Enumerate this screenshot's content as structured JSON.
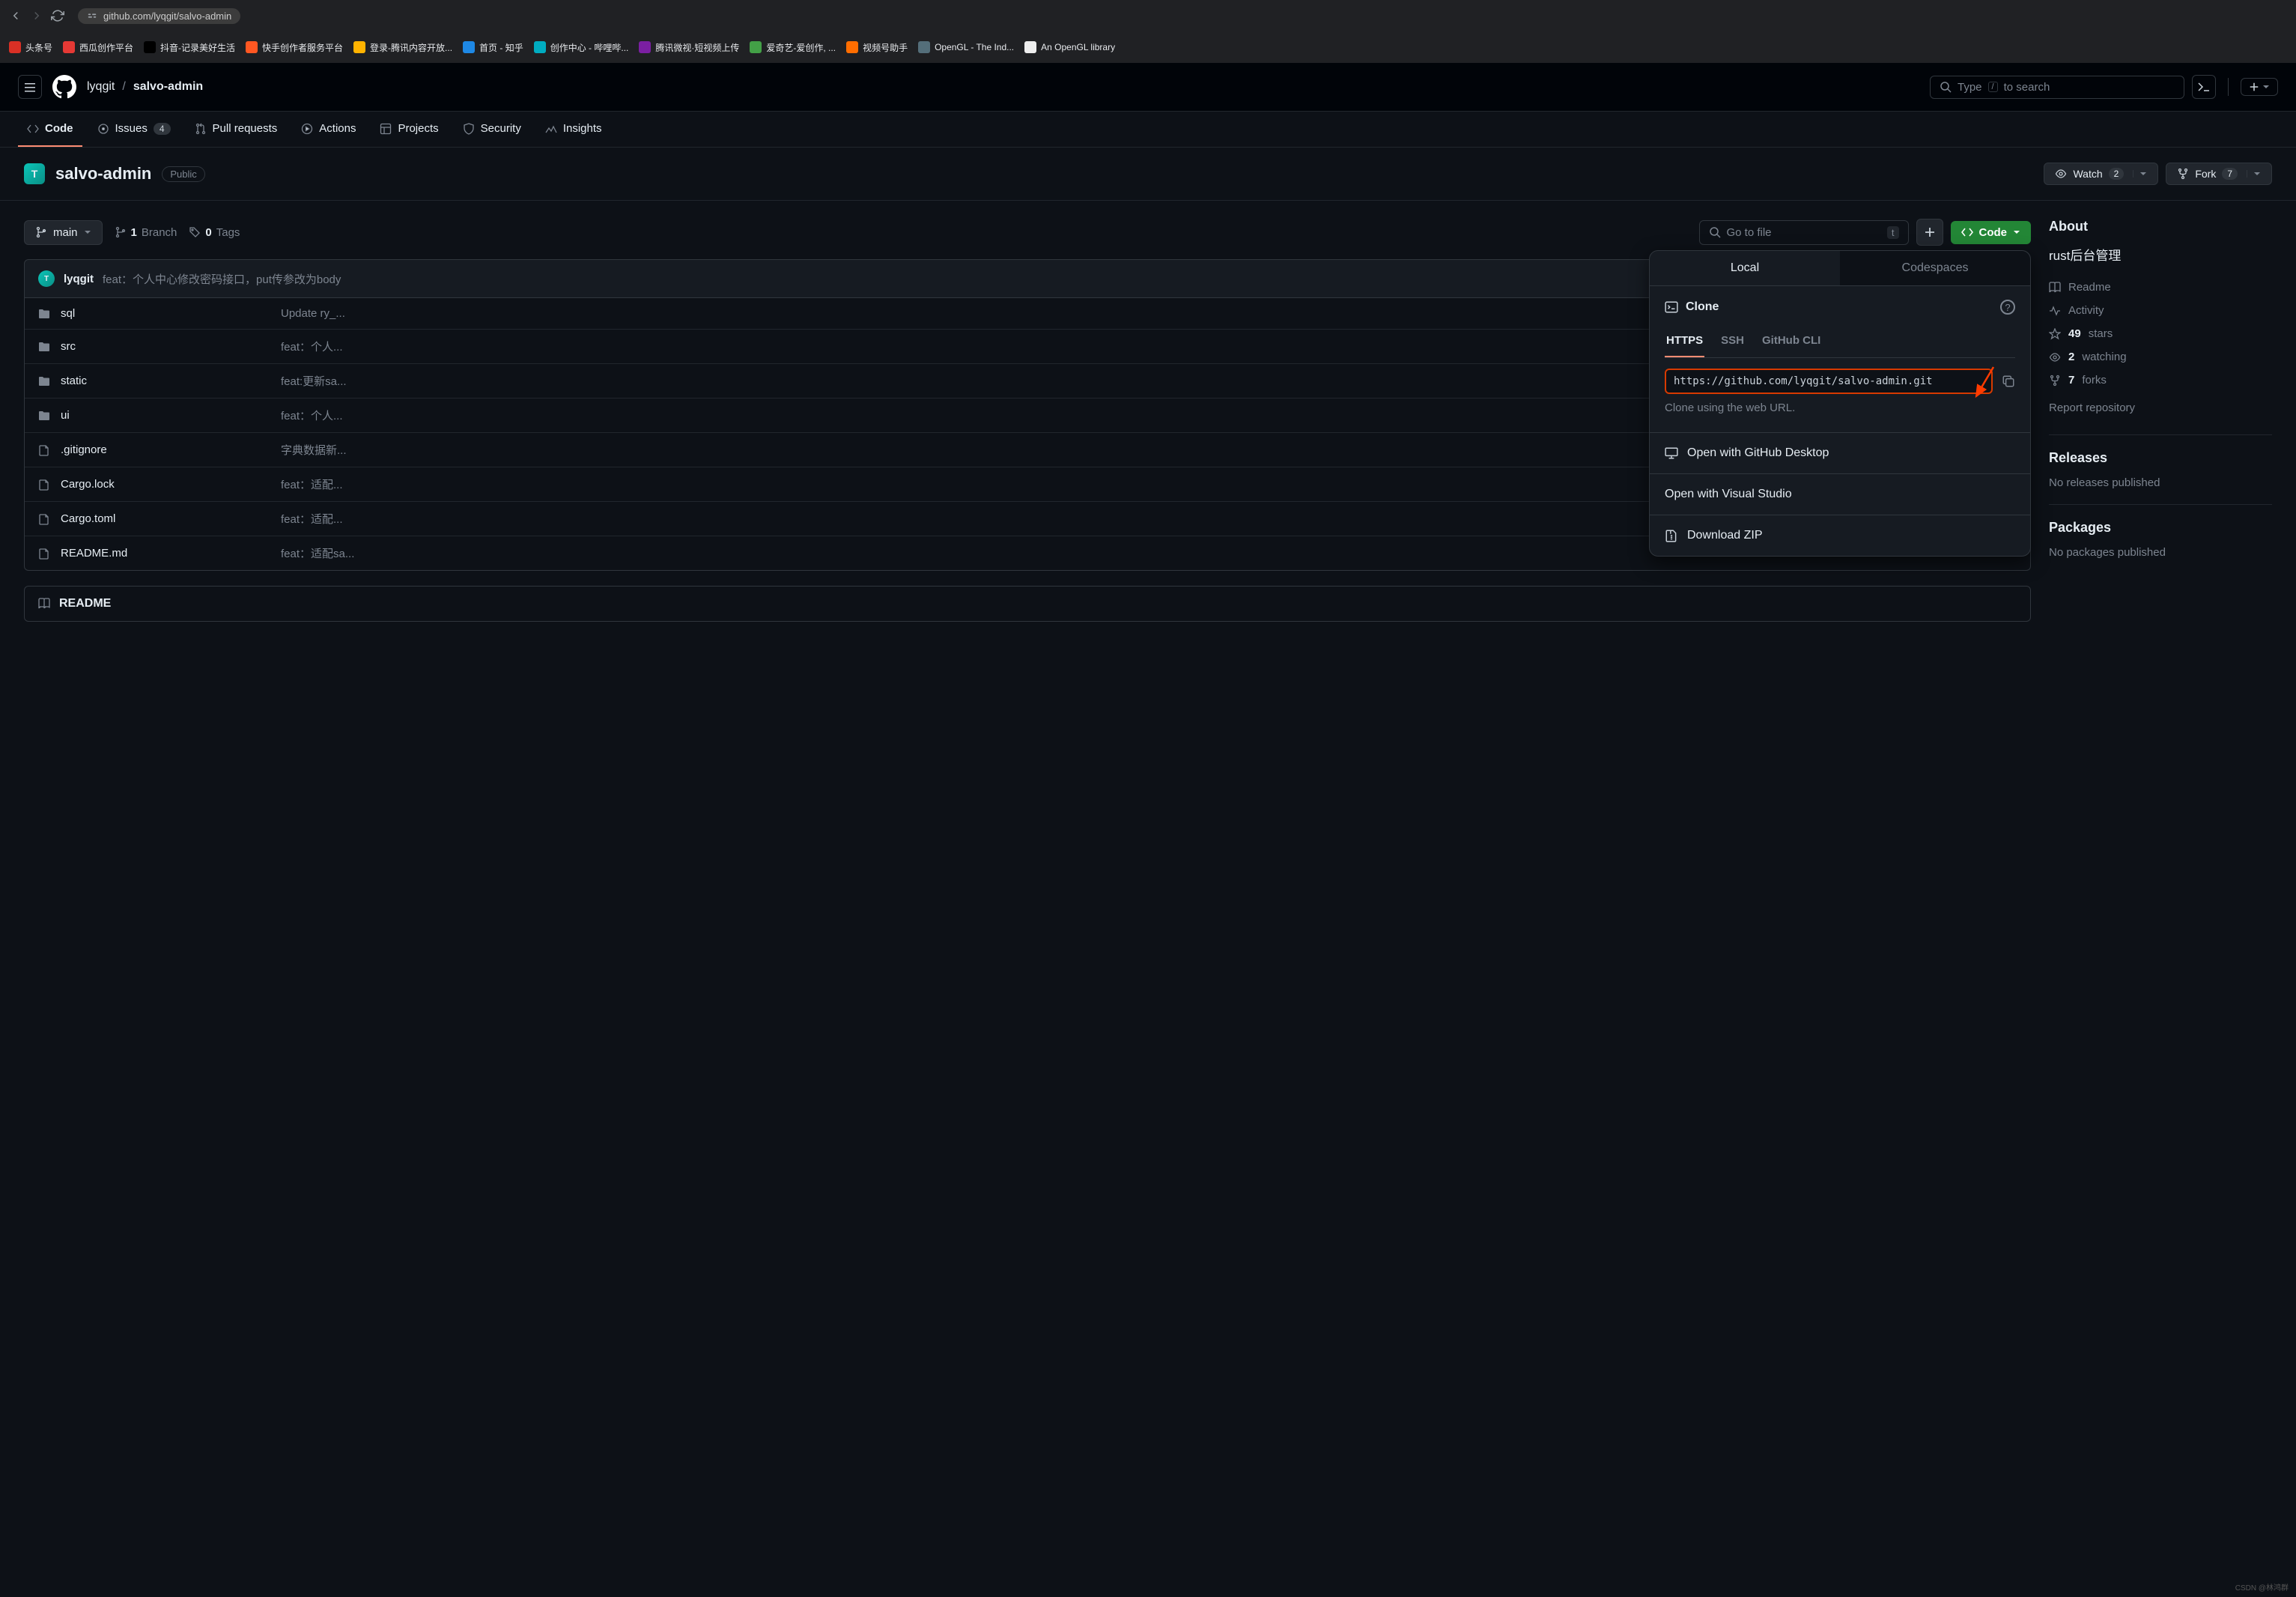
{
  "browser": {
    "url": "github.com/lyqgit/salvo-admin",
    "bookmarks": [
      {
        "label": "头条号",
        "color": "#d93025"
      },
      {
        "label": "西瓜创作平台",
        "color": "#e53935"
      },
      {
        "label": "抖音-记录美好生活",
        "color": "#000"
      },
      {
        "label": "快手创作者服务平台",
        "color": "#ff5722"
      },
      {
        "label": "登录-腾讯内容开放...",
        "color": "#ffb300"
      },
      {
        "label": "首页 - 知乎",
        "color": "#1e88e5"
      },
      {
        "label": "创作中心 - 哔哩哔...",
        "color": "#00acc1"
      },
      {
        "label": "腾讯微视·短视频上传",
        "color": "#7b1fa2"
      },
      {
        "label": "爱奇艺-爱创作, ...",
        "color": "#43a047"
      },
      {
        "label": "视频号助手",
        "color": "#ff6d00"
      },
      {
        "label": "OpenGL - The Ind...",
        "color": "#546e7a"
      },
      {
        "label": "An OpenGL library",
        "color": "#eee"
      }
    ]
  },
  "header": {
    "owner": "lyqgit",
    "repo": "salvo-admin",
    "search_placeholder_pre": "Type ",
    "search_placeholder_post": " to search",
    "search_kbd": "/"
  },
  "nav": {
    "items": [
      {
        "label": "Code",
        "active": true
      },
      {
        "label": "Issues",
        "count": "4"
      },
      {
        "label": "Pull requests"
      },
      {
        "label": "Actions"
      },
      {
        "label": "Projects"
      },
      {
        "label": "Security"
      },
      {
        "label": "Insights"
      }
    ]
  },
  "repo": {
    "name": "salvo-admin",
    "visibility": "Public",
    "watch_label": "Watch",
    "watch_count": "2",
    "fork_label": "Fork",
    "fork_count": "7"
  },
  "controls": {
    "branch": "main",
    "branches_count": "1",
    "branches_label": "Branch",
    "tags_count": "0",
    "tags_label": "Tags",
    "goto_placeholder": "Go to file",
    "goto_kbd": "t",
    "code_label": "Code"
  },
  "clone": {
    "tab_local": "Local",
    "tab_codespaces": "Codespaces",
    "title": "Clone",
    "tab_https": "HTTPS",
    "tab_ssh": "SSH",
    "tab_cli": "GitHub CLI",
    "url": "https://github.com/lyqgit/salvo-admin.git",
    "desc": "Clone using the web URL.",
    "opt_desktop": "Open with GitHub Desktop",
    "opt_vs": "Open with Visual Studio",
    "opt_zip": "Download ZIP"
  },
  "commit": {
    "author": "lyqgit",
    "message": "feat：个人中心修改密码接口，put传参改为body"
  },
  "files": [
    {
      "type": "dir",
      "name": "sql",
      "msg": "Update ry_..."
    },
    {
      "type": "dir",
      "name": "src",
      "msg": "feat：个人..."
    },
    {
      "type": "dir",
      "name": "static",
      "msg": "feat:更新sa..."
    },
    {
      "type": "dir",
      "name": "ui",
      "msg": "feat：个人..."
    },
    {
      "type": "file",
      "name": ".gitignore",
      "msg": "字典数据新..."
    },
    {
      "type": "file",
      "name": "Cargo.lock",
      "msg": "feat：适配..."
    },
    {
      "type": "file",
      "name": "Cargo.toml",
      "msg": "feat：适配..."
    },
    {
      "type": "file",
      "name": "README.md",
      "msg": "feat：适配sa..."
    }
  ],
  "readme_tab": "README",
  "sidebar": {
    "about_title": "About",
    "description": "rust后台管理",
    "readme": "Readme",
    "activity": "Activity",
    "stars_count": "49",
    "stars_label": "stars",
    "watching_count": "2",
    "watching_label": "watching",
    "forks_count": "7",
    "forks_label": "forks",
    "report": "Report repository",
    "releases_title": "Releases",
    "releases_text": "No releases published",
    "packages_title": "Packages",
    "packages_text": "No packages published"
  },
  "watermark": "CSDN @林鸿群"
}
